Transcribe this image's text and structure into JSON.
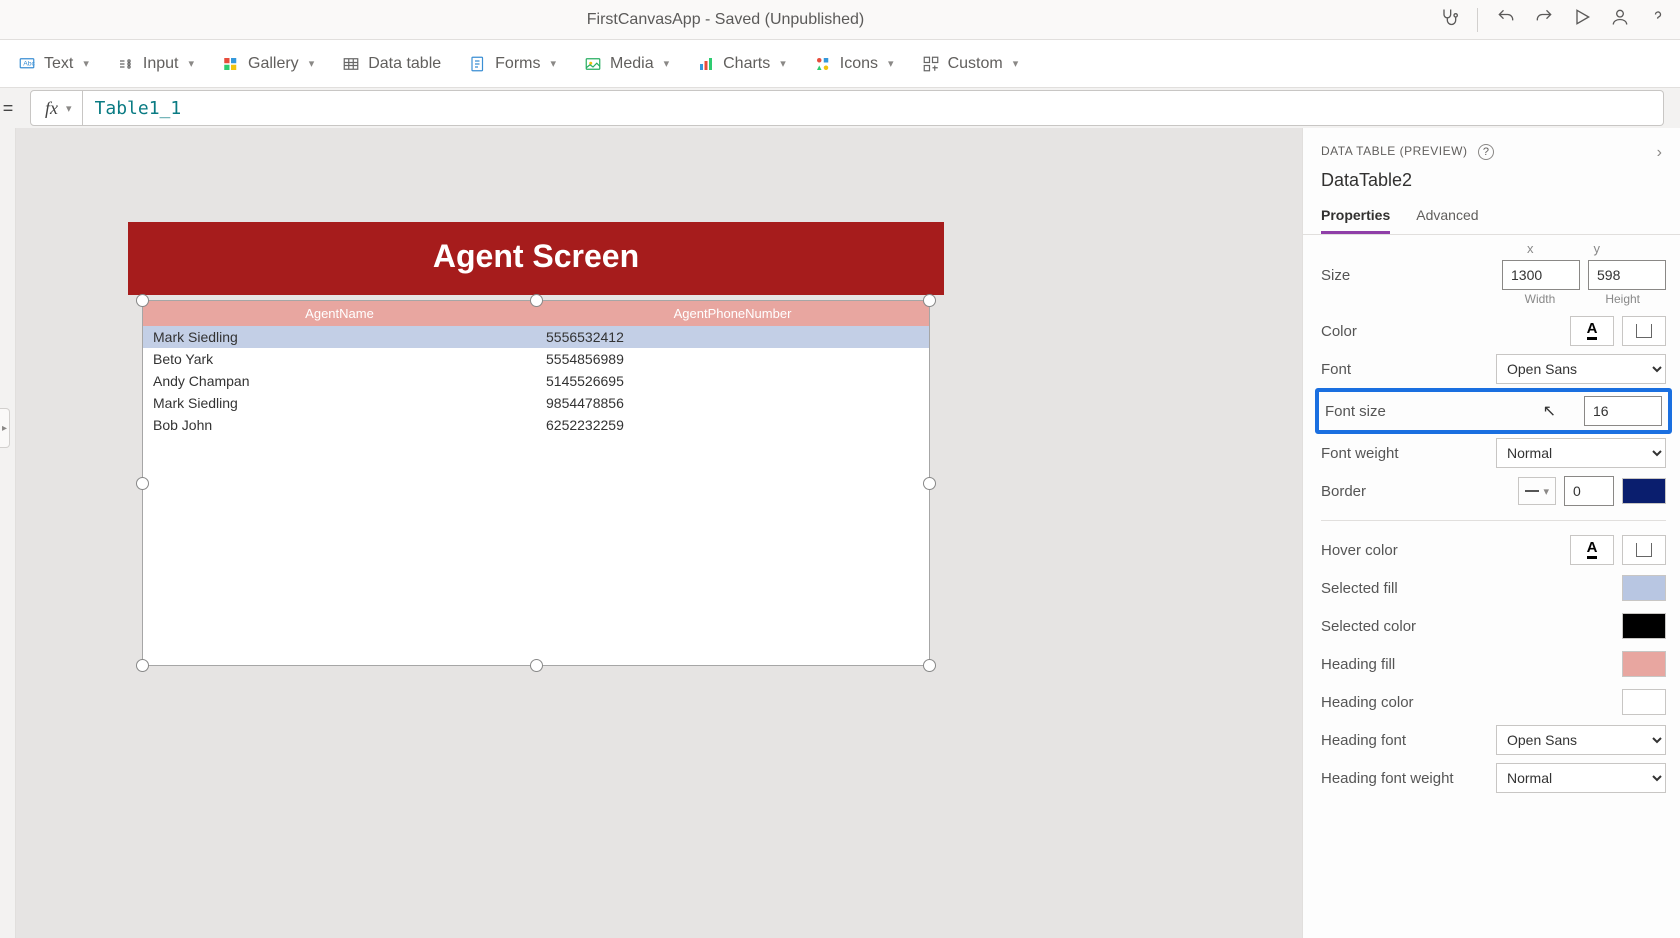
{
  "header": {
    "title": "FirstCanvasApp - Saved (Unpublished)"
  },
  "ribbon": {
    "text": "Text",
    "input": "Input",
    "gallery": "Gallery",
    "datatable": "Data table",
    "forms": "Forms",
    "media": "Media",
    "charts": "Charts",
    "icons": "Icons",
    "custom": "Custom"
  },
  "formula": {
    "value": "Table1_1"
  },
  "canvas": {
    "screenTitle": "Agent Screen",
    "table": {
      "columns": [
        "AgentName",
        "AgentPhoneNumber"
      ],
      "rows": [
        {
          "name": "Mark Siedling",
          "phone": "5556532412",
          "selected": true
        },
        {
          "name": "Beto Yark",
          "phone": "5554856989",
          "selected": false
        },
        {
          "name": "Andy Champan",
          "phone": "5145526695",
          "selected": false
        },
        {
          "name": "Mark Siedling",
          "phone": "9854478856",
          "selected": false
        },
        {
          "name": "Bob John",
          "phone": "6252232259",
          "selected": false
        }
      ]
    }
  },
  "rpane": {
    "category": "DATA TABLE (PREVIEW)",
    "objectName": "DataTable2",
    "tabs": {
      "properties": "Properties",
      "advanced": "Advanced"
    },
    "props": {
      "size_label": "Size",
      "width": "1300",
      "height": "598",
      "width_label": "Width",
      "height_label": "Height",
      "color_label": "Color",
      "font_label": "Font",
      "font_value": "Open Sans",
      "fontsize_label": "Font size",
      "fontsize_value": "16",
      "fontweight_label": "Font weight",
      "fontweight_value": "Normal",
      "border_label": "Border",
      "border_value": "0",
      "hover_label": "Hover color",
      "selfill_label": "Selected fill",
      "selcolor_label": "Selected color",
      "headfill_label": "Heading fill",
      "headcolor_label": "Heading color",
      "headfont_label": "Heading font",
      "headfont_value": "Open Sans",
      "headweight_label": "Heading font weight",
      "headweight_value": "Normal"
    },
    "colors": {
      "border": "#0a1e6e",
      "selected_fill": "#b8c6e2",
      "selected_color": "#000000",
      "heading_fill": "#e8a6a0",
      "heading_color": "#ffffff"
    }
  }
}
